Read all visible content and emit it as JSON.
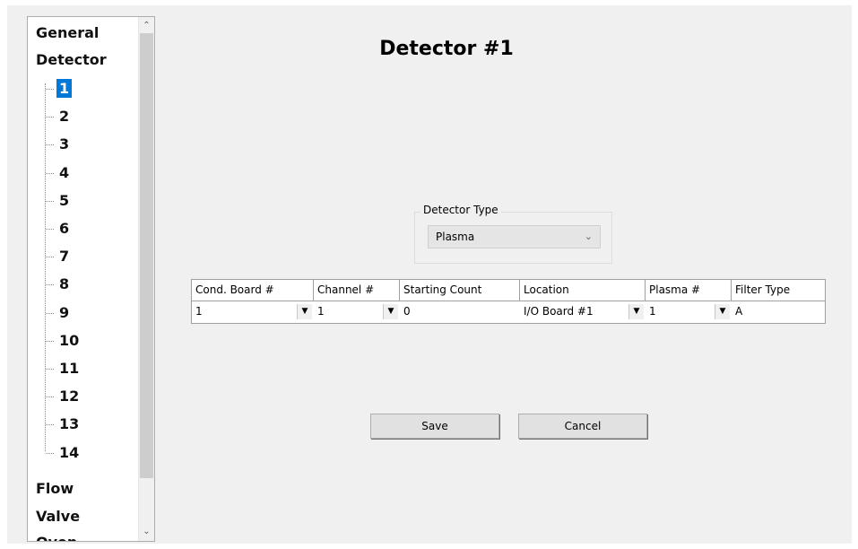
{
  "tree": {
    "top_items_before": [
      "General",
      "Detector"
    ],
    "detector_children": [
      "1",
      "2",
      "3",
      "4",
      "5",
      "6",
      "7",
      "8",
      "9",
      "10",
      "11",
      "12",
      "13",
      "14"
    ],
    "selected_child": "1",
    "top_items_after": [
      "Flow",
      "Valve",
      "Oven"
    ],
    "scroll_up_icon": "chevron-up-icon",
    "scroll_down_icon": "chevron-down-icon"
  },
  "page_title": "Detector #1",
  "detector_type": {
    "group_label": "Detector Type",
    "selected": "Plasma",
    "icon": "chevron-down-icon"
  },
  "grid": {
    "columns": [
      "Cond. Board #",
      "Channel #",
      "Starting Count",
      "Location",
      "Plasma #",
      "Filter Type"
    ],
    "row": [
      "1",
      "1",
      "0",
      "I/O Board #1",
      "1",
      "A"
    ],
    "dropdown_columns": [
      0,
      1,
      3,
      4
    ]
  },
  "buttons": {
    "save": "Save",
    "cancel": "Cancel"
  }
}
